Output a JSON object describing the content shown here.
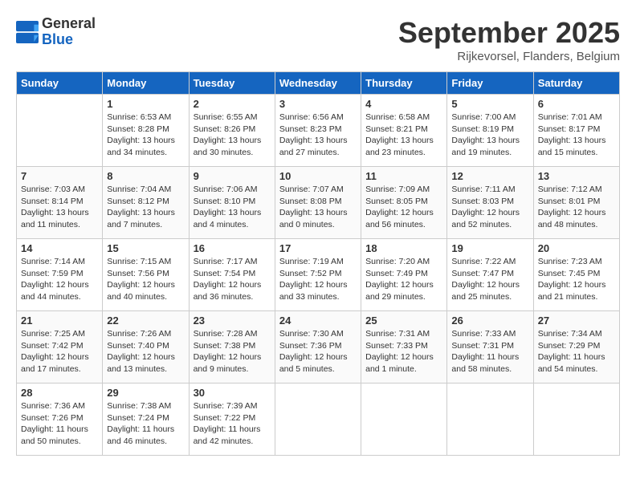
{
  "header": {
    "logo_general": "General",
    "logo_blue": "Blue",
    "month_title": "September 2025",
    "subtitle": "Rijkevorsel, Flanders, Belgium"
  },
  "days_of_week": [
    "Sunday",
    "Monday",
    "Tuesday",
    "Wednesday",
    "Thursday",
    "Friday",
    "Saturday"
  ],
  "weeks": [
    [
      {
        "day": "",
        "info": ""
      },
      {
        "day": "1",
        "info": "Sunrise: 6:53 AM\nSunset: 8:28 PM\nDaylight: 13 hours\nand 34 minutes."
      },
      {
        "day": "2",
        "info": "Sunrise: 6:55 AM\nSunset: 8:26 PM\nDaylight: 13 hours\nand 30 minutes."
      },
      {
        "day": "3",
        "info": "Sunrise: 6:56 AM\nSunset: 8:23 PM\nDaylight: 13 hours\nand 27 minutes."
      },
      {
        "day": "4",
        "info": "Sunrise: 6:58 AM\nSunset: 8:21 PM\nDaylight: 13 hours\nand 23 minutes."
      },
      {
        "day": "5",
        "info": "Sunrise: 7:00 AM\nSunset: 8:19 PM\nDaylight: 13 hours\nand 19 minutes."
      },
      {
        "day": "6",
        "info": "Sunrise: 7:01 AM\nSunset: 8:17 PM\nDaylight: 13 hours\nand 15 minutes."
      }
    ],
    [
      {
        "day": "7",
        "info": "Sunrise: 7:03 AM\nSunset: 8:14 PM\nDaylight: 13 hours\nand 11 minutes."
      },
      {
        "day": "8",
        "info": "Sunrise: 7:04 AM\nSunset: 8:12 PM\nDaylight: 13 hours\nand 7 minutes."
      },
      {
        "day": "9",
        "info": "Sunrise: 7:06 AM\nSunset: 8:10 PM\nDaylight: 13 hours\nand 4 minutes."
      },
      {
        "day": "10",
        "info": "Sunrise: 7:07 AM\nSunset: 8:08 PM\nDaylight: 13 hours\nand 0 minutes."
      },
      {
        "day": "11",
        "info": "Sunrise: 7:09 AM\nSunset: 8:05 PM\nDaylight: 12 hours\nand 56 minutes."
      },
      {
        "day": "12",
        "info": "Sunrise: 7:11 AM\nSunset: 8:03 PM\nDaylight: 12 hours\nand 52 minutes."
      },
      {
        "day": "13",
        "info": "Sunrise: 7:12 AM\nSunset: 8:01 PM\nDaylight: 12 hours\nand 48 minutes."
      }
    ],
    [
      {
        "day": "14",
        "info": "Sunrise: 7:14 AM\nSunset: 7:59 PM\nDaylight: 12 hours\nand 44 minutes."
      },
      {
        "day": "15",
        "info": "Sunrise: 7:15 AM\nSunset: 7:56 PM\nDaylight: 12 hours\nand 40 minutes."
      },
      {
        "day": "16",
        "info": "Sunrise: 7:17 AM\nSunset: 7:54 PM\nDaylight: 12 hours\nand 36 minutes."
      },
      {
        "day": "17",
        "info": "Sunrise: 7:19 AM\nSunset: 7:52 PM\nDaylight: 12 hours\nand 33 minutes."
      },
      {
        "day": "18",
        "info": "Sunrise: 7:20 AM\nSunset: 7:49 PM\nDaylight: 12 hours\nand 29 minutes."
      },
      {
        "day": "19",
        "info": "Sunrise: 7:22 AM\nSunset: 7:47 PM\nDaylight: 12 hours\nand 25 minutes."
      },
      {
        "day": "20",
        "info": "Sunrise: 7:23 AM\nSunset: 7:45 PM\nDaylight: 12 hours\nand 21 minutes."
      }
    ],
    [
      {
        "day": "21",
        "info": "Sunrise: 7:25 AM\nSunset: 7:42 PM\nDaylight: 12 hours\nand 17 minutes."
      },
      {
        "day": "22",
        "info": "Sunrise: 7:26 AM\nSunset: 7:40 PM\nDaylight: 12 hours\nand 13 minutes."
      },
      {
        "day": "23",
        "info": "Sunrise: 7:28 AM\nSunset: 7:38 PM\nDaylight: 12 hours\nand 9 minutes."
      },
      {
        "day": "24",
        "info": "Sunrise: 7:30 AM\nSunset: 7:36 PM\nDaylight: 12 hours\nand 5 minutes."
      },
      {
        "day": "25",
        "info": "Sunrise: 7:31 AM\nSunset: 7:33 PM\nDaylight: 12 hours\nand 1 minute."
      },
      {
        "day": "26",
        "info": "Sunrise: 7:33 AM\nSunset: 7:31 PM\nDaylight: 11 hours\nand 58 minutes."
      },
      {
        "day": "27",
        "info": "Sunrise: 7:34 AM\nSunset: 7:29 PM\nDaylight: 11 hours\nand 54 minutes."
      }
    ],
    [
      {
        "day": "28",
        "info": "Sunrise: 7:36 AM\nSunset: 7:26 PM\nDaylight: 11 hours\nand 50 minutes."
      },
      {
        "day": "29",
        "info": "Sunrise: 7:38 AM\nSunset: 7:24 PM\nDaylight: 11 hours\nand 46 minutes."
      },
      {
        "day": "30",
        "info": "Sunrise: 7:39 AM\nSunset: 7:22 PM\nDaylight: 11 hours\nand 42 minutes."
      },
      {
        "day": "",
        "info": ""
      },
      {
        "day": "",
        "info": ""
      },
      {
        "day": "",
        "info": ""
      },
      {
        "day": "",
        "info": ""
      }
    ]
  ]
}
